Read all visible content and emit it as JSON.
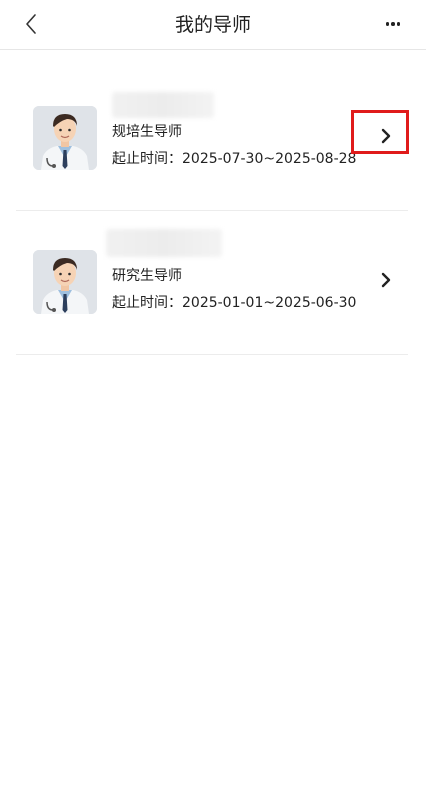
{
  "header": {
    "title": "我的导师"
  },
  "mentors": [
    {
      "role": "规培生导师",
      "date_label": "起止时间：",
      "date_range": "2025-07-30~2025-08-28"
    },
    {
      "role": "研究生导师",
      "date_label": "起止时间：",
      "date_range": "2025-01-01~2025-06-30"
    }
  ],
  "colors": {
    "highlight": "#e01b1b",
    "divider": "#ececec"
  },
  "icons": {
    "back": "chevron-left-icon",
    "more": "more-horizontal-icon",
    "row_arrow": "chevron-right-icon"
  }
}
